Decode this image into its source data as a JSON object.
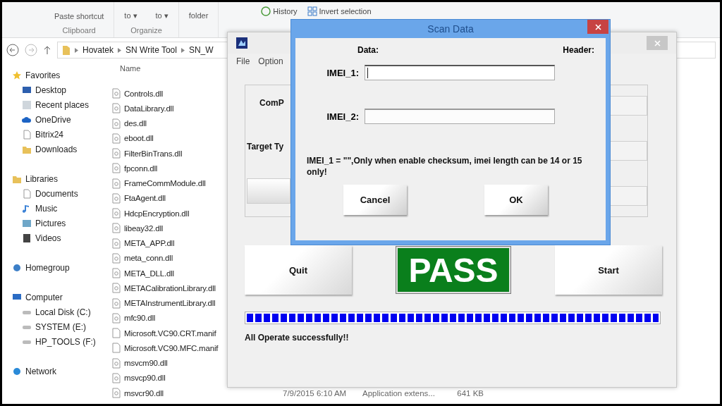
{
  "ribbon": {
    "groups": [
      {
        "label": "Clipboard",
        "items": [
          "Paste shortcut"
        ]
      },
      {
        "label": "Organize",
        "items": [
          "to ▾",
          "to ▾"
        ]
      },
      {
        "items": [
          "folder"
        ]
      }
    ],
    "extra": [
      "History",
      "Invert selection"
    ]
  },
  "address": {
    "path": [
      "Hovatek",
      "SN Write Tool",
      "SN_W"
    ]
  },
  "nav": [
    {
      "label": "Favorites",
      "children": [
        {
          "label": "Desktop"
        },
        {
          "label": "Recent places"
        },
        {
          "label": "OneDrive"
        },
        {
          "label": "Bitrix24"
        },
        {
          "label": "Downloads"
        }
      ]
    },
    {
      "label": "Libraries",
      "children": [
        {
          "label": "Documents"
        },
        {
          "label": "Music"
        },
        {
          "label": "Pictures"
        },
        {
          "label": "Videos"
        }
      ]
    },
    {
      "label": "Homegroup"
    },
    {
      "label": "Computer",
      "children": [
        {
          "label": "Local Disk (C:)"
        },
        {
          "label": "SYSTEM (E:)"
        },
        {
          "label": "HP_TOOLS (F:)"
        }
      ]
    },
    {
      "label": "Network"
    }
  ],
  "files": {
    "column_header": "Name",
    "rows": [
      {
        "name": "Controls.dll",
        "kind": "dll"
      },
      {
        "name": "DataLibrary.dll",
        "kind": "dll"
      },
      {
        "name": "des.dll",
        "kind": "dll"
      },
      {
        "name": "eboot.dll",
        "kind": "dll"
      },
      {
        "name": "FilterBinTrans.dll",
        "kind": "dll"
      },
      {
        "name": "fpconn.dll",
        "kind": "dll"
      },
      {
        "name": "FrameCommModule.dll",
        "kind": "dll"
      },
      {
        "name": "FtaAgent.dll",
        "kind": "dll"
      },
      {
        "name": "HdcpEncryption.dll",
        "kind": "dll"
      },
      {
        "name": "libeay32.dll",
        "kind": "dll"
      },
      {
        "name": "META_APP.dll",
        "kind": "dll"
      },
      {
        "name": "meta_conn.dll",
        "kind": "dll"
      },
      {
        "name": "META_DLL.dll",
        "kind": "dll"
      },
      {
        "name": "METACalibrationLibrary.dll",
        "kind": "dll"
      },
      {
        "name": "METAInstrumentLibrary.dll",
        "kind": "dll"
      },
      {
        "name": "mfc90.dll",
        "kind": "dll"
      },
      {
        "name": "Microsoft.VC90.CRT.manif",
        "kind": "file"
      },
      {
        "name": "Microsoft.VC90.MFC.manif",
        "kind": "file"
      },
      {
        "name": "msvcm90.dll",
        "kind": "dll"
      },
      {
        "name": "msvcp90.dll",
        "kind": "dll"
      },
      {
        "name": "msvcr90.dll",
        "kind": "dll",
        "date": "7/9/2015 6:10 AM",
        "type": "Application extens...",
        "size": "641 KB"
      }
    ]
  },
  "tool_window": {
    "menu": [
      "File",
      "Option"
    ],
    "labels": [
      "ComP",
      "Target Ty"
    ],
    "buttons": [
      "Quit",
      "Start"
    ],
    "result": "PASS",
    "progress": {
      "level": 1
    },
    "status": "All Operate successfully!!"
  },
  "dialog": {
    "title": "Scan Data",
    "data_label": "Data:",
    "header_label": "Header:",
    "fields": [
      {
        "label": "IMEI_1:",
        "focused": true
      },
      {
        "label": "IMEI_2:",
        "focused": false
      }
    ],
    "message": "IMEI_1 = \"\",Only when enable checksum, imei length can be 14 or 15 only!",
    "buttons": [
      "Cancel",
      "OK"
    ]
  }
}
